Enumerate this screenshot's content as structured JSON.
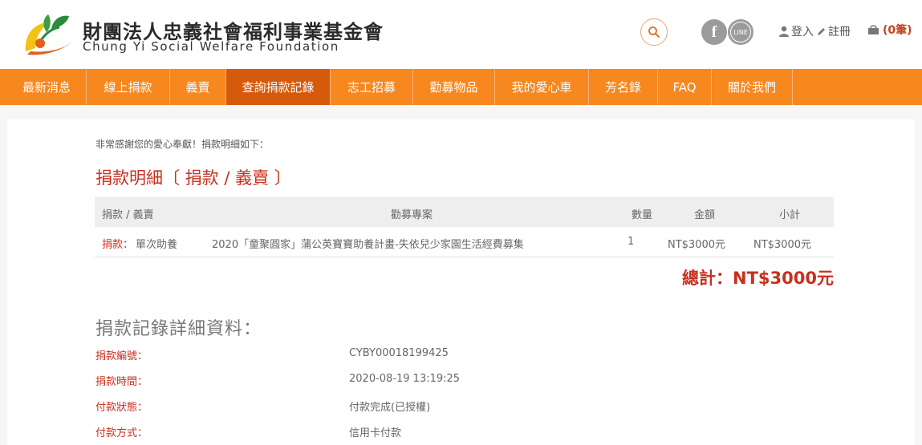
{
  "header": {
    "org_name_zh": "財團法人忠義社會福利事業基金會",
    "org_name_en": "Chung Yi Social Welfare Foundation",
    "social": {
      "facebook_glyph": "f",
      "line_glyph": "LINE"
    },
    "login_label": "登入",
    "register_label": "註冊",
    "cart_label": "(0筆)"
  },
  "nav": {
    "items": [
      {
        "label": "最新消息"
      },
      {
        "label": "線上捐款"
      },
      {
        "label": "義賣"
      },
      {
        "label": "查詢捐款記錄"
      },
      {
        "label": "志工招募"
      },
      {
        "label": "勸募物品"
      },
      {
        "label": "我的愛心車"
      },
      {
        "label": "芳名錄"
      },
      {
        "label": "FAQ"
      },
      {
        "label": "關於我們"
      }
    ],
    "active_index": 3
  },
  "main": {
    "thanks_text": "非常感謝您的愛心奉獻！捐款明細如下：",
    "section_title": "捐款明細〔 捐款 / 義賣 〕",
    "table": {
      "headers": [
        "捐款 / 義賣",
        "勸募專案",
        "數量",
        "金額",
        "小計"
      ],
      "rows": [
        {
          "type": "捐款：",
          "subtype": "單次助養",
          "project": "2020「童聚圓家」蒲公英寶寶助養計畫-失依兒少家園生活經費募集",
          "qty": "1",
          "amount": "NT$3000元",
          "subtotal": "NT$3000元"
        }
      ]
    },
    "total_text": "總計：NT$3000元",
    "detail_title": "捐款記錄詳細資料：",
    "details": [
      {
        "label": "捐款編號：",
        "value": "CYBY00018199425"
      },
      {
        "label": "捐款時間：",
        "value": "2020-08-19 13:19:25"
      },
      {
        "label": "付款狀態：",
        "value": "付款完成(已授權)"
      },
      {
        "label": "付款方式：",
        "value": "信用卡付款"
      }
    ]
  },
  "colors": {
    "nav_bg": "#f7871f",
    "nav_active": "#d65a0c",
    "accent_red": "#c8301e"
  },
  "icons": [
    "logo-icon",
    "search-icon",
    "facebook-icon",
    "line-icon",
    "user-icon",
    "pencil-icon",
    "cart-icon"
  ]
}
